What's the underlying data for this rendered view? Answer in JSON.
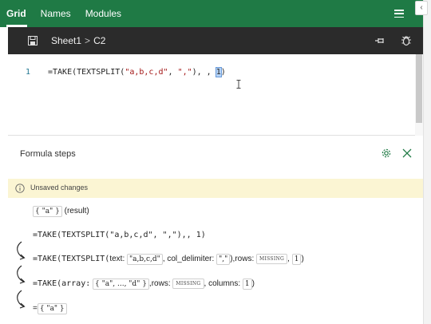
{
  "nav": {
    "tabs": [
      {
        "label": "Grid",
        "active": true
      },
      {
        "label": "Names",
        "active": false
      },
      {
        "label": "Modules",
        "active": false
      }
    ],
    "menu_icon": "hamburger-icon",
    "edge_button_label": "‹"
  },
  "pathbar": {
    "sheet": "Sheet1",
    "separator": ">",
    "cell": "C2"
  },
  "editor": {
    "line_number": "1",
    "formula_prefix": "=TAKE(TEXTSPLIT(",
    "formula_str1": "\"a,b,c,d\"",
    "formula_mid": ", ",
    "formula_str2": "\",\"",
    "formula_after": "), , ",
    "formula_selected": "1",
    "formula_suffix": ")"
  },
  "steps_panel": {
    "title": "Formula steps",
    "warning": "Unsaved changes",
    "steps": [
      {
        "result_bubble": "{ \"a\" }",
        "result_label": "(result)"
      },
      {
        "text": "=TAKE(TEXTSPLIT(\"a,b,c,d\", \",\"),, 1)"
      },
      {
        "prefix": "=TAKE(TEXTSPLIT(",
        "arg1_label": "text:",
        "arg1_value": "\"a,b,c,d\"",
        "arg2_label": "col_delimiter:",
        "arg2_value": "\",\"",
        "mid": "),rows:",
        "missing": "MISSING",
        "arg4_value": "1",
        "suffix": ")"
      },
      {
        "prefix": "=TAKE(array:",
        "array_value": "{ \"a\", ..., \"d\" }",
        "mid": ",rows:",
        "missing": "MISSING",
        "cols_label": "columns:",
        "cols_value": "1",
        "suffix": ")"
      },
      {
        "prefix": "=",
        "result_bubble": "{ \"a\" }"
      }
    ]
  },
  "colors": {
    "nav_bg": "#1f7a45",
    "pathbar_bg": "#2b2b2b",
    "warning_bg": "#fbf5d3",
    "accent_green": "#1f7a45"
  }
}
